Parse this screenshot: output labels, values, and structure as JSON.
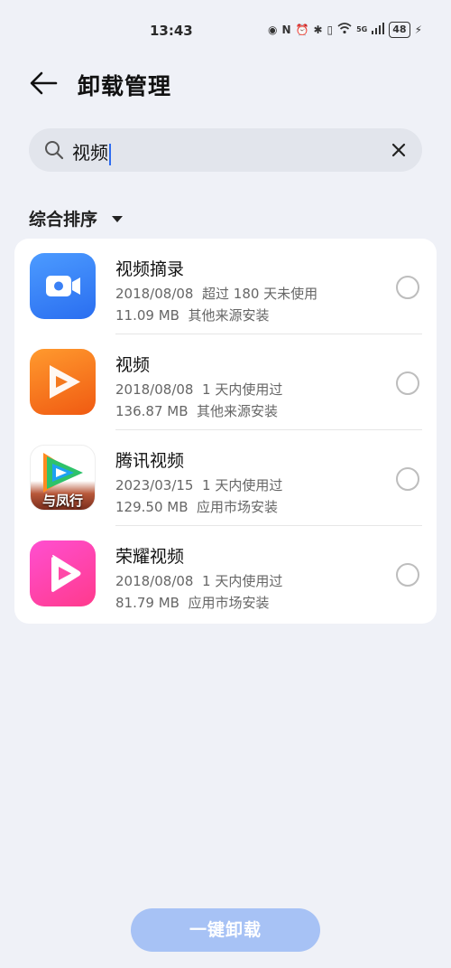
{
  "status_bar": {
    "time": "13:43",
    "network": "5G",
    "battery": "48"
  },
  "header": {
    "title": "卸载管理"
  },
  "search": {
    "value": "视频"
  },
  "sort": {
    "label": "综合排序"
  },
  "apps": [
    {
      "name": "视频摘录",
      "date": "2018/08/08",
      "usage": "超过 180 天未使用",
      "size": "11.09 MB",
      "source": "其他来源安装",
      "icon": "video-excerpt-icon",
      "selected": false
    },
    {
      "name": "视频",
      "date": "2018/08/08",
      "usage": "1 天内使用过",
      "size": "136.87 MB",
      "source": "其他来源安装",
      "icon": "video-app-icon",
      "selected": false
    },
    {
      "name": "腾讯视频",
      "date": "2023/03/15",
      "usage": "1 天内使用过",
      "size": "129.50 MB",
      "source": "应用市场安装",
      "icon": "tencent-video-icon",
      "icon_text": "与凤行",
      "selected": false
    },
    {
      "name": "荣耀视频",
      "date": "2018/08/08",
      "usage": "1 天内使用过",
      "size": "81.79 MB",
      "source": "应用市场安装",
      "icon": "honor-video-icon",
      "selected": false
    }
  ],
  "footer": {
    "uninstall_label": "一键卸载"
  },
  "colors": {
    "accent": "#2d6cf0",
    "button_disabled": "#a7c2f5",
    "background": "#eff1f7"
  }
}
